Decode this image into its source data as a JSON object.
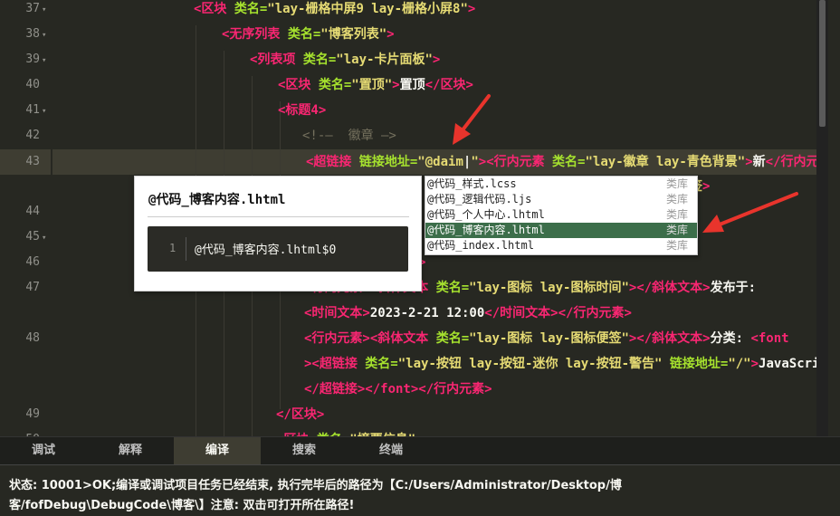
{
  "editor": {
    "gutter": [
      {
        "num": "37",
        "fold": true
      },
      {
        "num": "38",
        "fold": true
      },
      {
        "num": "39",
        "fold": true
      },
      {
        "num": "40",
        "fold": false
      },
      {
        "num": "41",
        "fold": true
      },
      {
        "num": "42",
        "fold": false
      },
      {
        "num": "43",
        "fold": false
      },
      {
        "num": "44",
        "fold": false
      },
      {
        "num": "45",
        "fold": true
      },
      {
        "num": "46",
        "fold": false
      },
      {
        "num": "47",
        "fold": false
      },
      {
        "num": "48",
        "fold": false
      },
      {
        "num": "49",
        "fold": false
      },
      {
        "num": "50",
        "fold": false
      }
    ],
    "lines": {
      "l37": [
        [
          "tg",
          "<区块 "
        ],
        [
          "at",
          "类名="
        ],
        [
          "st",
          "\"lay-栅格中屏9 lay-栅格小屏8\""
        ],
        [
          "tg",
          ">"
        ]
      ],
      "l38": [
        [
          "tg",
          "<无序列表 "
        ],
        [
          "at",
          "类名="
        ],
        [
          "st",
          "\"博客列表\""
        ],
        [
          "tg",
          ">"
        ]
      ],
      "l39": [
        [
          "tg",
          "<列表项 "
        ],
        [
          "at",
          "类名="
        ],
        [
          "st",
          "\"lay-卡片面板\""
        ],
        [
          "tg",
          ">"
        ]
      ],
      "l40": [
        [
          "tg",
          "<区块 "
        ],
        [
          "at",
          "类名="
        ],
        [
          "st",
          "\"置顶\""
        ],
        [
          "tg",
          ">"
        ],
        [
          "tx",
          "置顶"
        ],
        [
          "tg",
          "</区块>"
        ]
      ],
      "l41": [
        [
          "tg",
          "<标题4>"
        ]
      ],
      "l42": [
        [
          "cm",
          "<!-—  徽章 —>"
        ]
      ],
      "l43": [
        [
          "tg",
          "<超链接 "
        ],
        [
          "at",
          "链接地址="
        ],
        [
          "st",
          "\"@daim"
        ],
        [
          "tx",
          "|"
        ],
        [
          "st",
          "\""
        ],
        [
          "tg",
          ">"
        ],
        [
          "tg",
          "<行内元素 "
        ],
        [
          "at",
          "类名="
        ],
        [
          "st",
          "\"lay-徽章 lay-青色背景\""
        ],
        [
          "tg",
          ">"
        ],
        [
          "tx",
          "新"
        ],
        [
          "tg",
          "</行内元素"
        ]
      ],
      "l43b": [
        [
          "st",
          "签"
        ],
        [
          "tg",
          ">"
        ]
      ],
      "l44b": [
        [
          "tg",
          ">"
        ]
      ],
      "l47": [
        [
          "tg",
          "<行内元素>"
        ],
        [
          "tg",
          "<斜体文本 "
        ],
        [
          "at",
          "类名="
        ],
        [
          "st",
          "\"lay-图标 lay-图标时间\""
        ],
        [
          "tg",
          "></斜体文本>"
        ],
        [
          "tx",
          "发布于:"
        ]
      ],
      "l47b": [
        [
          "tg",
          "<时间文本>"
        ],
        [
          "tx",
          "2023-2-21 12:00"
        ],
        [
          "tg",
          "</时间文本></行内元素>"
        ]
      ],
      "l48": [
        [
          "tg",
          "<行内元素><斜体文本 "
        ],
        [
          "at",
          "类名="
        ],
        [
          "st",
          "\"lay-图标 lay-图标便签\""
        ],
        [
          "tg",
          "></斜体文本>"
        ],
        [
          "tx",
          "分类: "
        ],
        [
          "tg",
          "<font"
        ]
      ],
      "l48b": [
        [
          "tg",
          "><超链接 "
        ],
        [
          "at",
          "类名="
        ],
        [
          "st",
          "\"lay-按钮 lay-按钮-迷你 lay-按钮-警告\""
        ],
        [
          "at",
          " 链接地址="
        ],
        [
          "st",
          "\"/\""
        ],
        [
          "tg",
          ">"
        ],
        [
          "tx",
          "JavaScript"
        ]
      ],
      "l48c": [
        [
          "tg",
          "</超链接></font></行内元素>"
        ]
      ],
      "l49": [
        [
          "tg",
          "</区块>"
        ]
      ],
      "l50": [
        [
          "tg",
          "<区块 "
        ],
        [
          "at",
          "类名="
        ],
        [
          "st",
          "\"摘要信息\""
        ]
      ]
    }
  },
  "autocomplete": {
    "items": [
      {
        "label": "@代码_样式.lcss",
        "kind": "类库"
      },
      {
        "label": "@代码_逻辑代码.ljs",
        "kind": "类库"
      },
      {
        "label": "@代码_个人中心.lhtml",
        "kind": "类库"
      },
      {
        "label": "@代码_博客内容.lhtml",
        "kind": "类库"
      },
      {
        "label": "@代码_index.lhtml",
        "kind": "类库"
      }
    ],
    "selected": 3
  },
  "preview": {
    "title": "@代码_博客内容.lhtml",
    "line_number": "1",
    "code": "@代码_博客内容.lhtml$0"
  },
  "tabs": [
    {
      "label": "调试",
      "active": false
    },
    {
      "label": "解释",
      "active": false
    },
    {
      "label": "编译",
      "active": true
    },
    {
      "label": "搜索",
      "active": false
    },
    {
      "label": "终端",
      "active": false
    }
  ],
  "status": {
    "line1": "状态: 10001>OK;编译或调试项目任务已经结束, 执行完毕后的路径为【C:/Users/Administrator/Desktop/博",
    "line2": "客/fofDebug\\DebugCode\\博客\\】注意: 双击可打开所在路径!"
  },
  "colors": {
    "background": "#272822",
    "tag": "#f92672",
    "attribute": "#a6e22e",
    "string": "#e6db74",
    "text": "#f8f8f2",
    "arrow": "#e8342c",
    "selection": "#3c6e4a"
  }
}
